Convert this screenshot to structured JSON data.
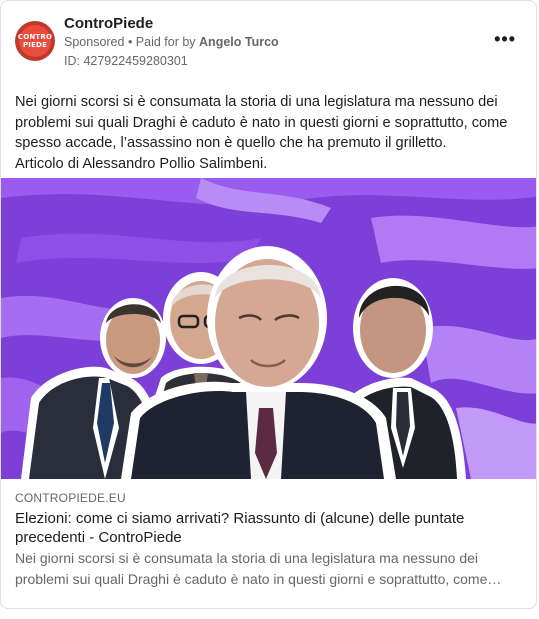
{
  "post": {
    "page_name": "ControPiede",
    "sponsored": "Sponsored",
    "separator": " • ",
    "paid_for_prefix": "Paid for by ",
    "paid_for_name": "Angelo Turco",
    "ad_id": "ID: 427922459280301",
    "more_label": "•••",
    "avatar_text": [
      "CONTRO",
      "PIEDE"
    ],
    "body_lines": [
      "Nei giorni scorsi si è consumata la storia di una legislatura ma nessuno dei",
      "problemi sui quali Draghi è caduto è nato in questi giorni e soprattutto, come",
      "spesso accade, l’assassino non è quello che ha premuto il grilletto.",
      "Articolo di Alessandro Pollio Salimbeni."
    ]
  },
  "link_preview": {
    "domain": "CONTROPIEDE.EU",
    "headline_line1": "Elezioni: come ci siamo arrivati? Riassunto di (alcune) delle puntate",
    "headline_line2": "precedenti - ControPiede",
    "desc_line1": "Nei giorni scorsi si è consumata la storia di una legislatura ma nessuno dei",
    "desc_line2": "problemi sui quali Draghi è caduto è nato in questi giorni e soprattutto, come…"
  },
  "colors": {
    "brand_red": "#c0392b",
    "image_purple": "#7b3fd6",
    "muted_text": "#65676b"
  }
}
